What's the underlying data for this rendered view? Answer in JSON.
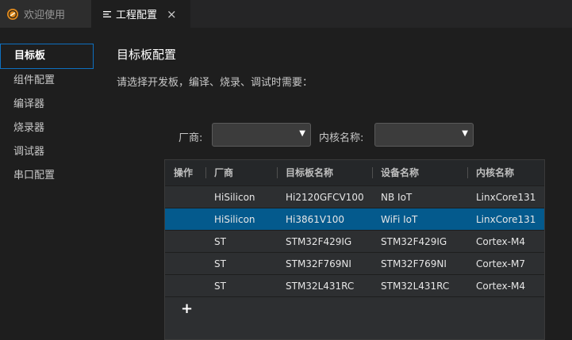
{
  "tabs": [
    {
      "label": "欢迎使用",
      "icon": "hicomponent-logo-icon",
      "active": false
    },
    {
      "label": "工程配置",
      "icon": "list-icon",
      "active": true,
      "close": "×"
    }
  ],
  "sidebar": {
    "items": [
      {
        "label": "目标板",
        "active": true
      },
      {
        "label": "组件配置"
      },
      {
        "label": "编译器"
      },
      {
        "label": "烧录器"
      },
      {
        "label": "调试器"
      },
      {
        "label": "串口配置"
      }
    ]
  },
  "main": {
    "title": "目标板配置",
    "subtitle": "请选择开发板，编译、烧录、调试时需要："
  },
  "filters": {
    "vendor_label": "厂商:",
    "vendor_value": "",
    "core_label": "内核名称:",
    "core_value": "",
    "caret": "▼"
  },
  "table": {
    "headers": [
      "操作",
      "厂商",
      "目标板名称",
      "设备名称",
      "内核名称"
    ],
    "rows": [
      {
        "op": "",
        "vendor": "HiSilicon",
        "board": "Hi2120GFCV100",
        "device": "NB IoT",
        "core": "LinxCore131",
        "selected": false
      },
      {
        "op": "",
        "vendor": "HiSilicon",
        "board": "Hi3861V100",
        "device": "WiFi IoT",
        "core": "LinxCore131",
        "selected": true
      },
      {
        "op": "",
        "vendor": "ST",
        "board": "STM32F429IG",
        "device": "STM32F429IG",
        "core": "Cortex-M4",
        "selected": false
      },
      {
        "op": "",
        "vendor": "ST",
        "board": "STM32F769NI",
        "device": "STM32F769NI",
        "core": "Cortex-M7",
        "selected": false
      },
      {
        "op": "",
        "vendor": "ST",
        "board": "STM32L431RC",
        "device": "STM32L431RC",
        "core": "Cortex-M4",
        "selected": false
      }
    ],
    "add_label": "+"
  },
  "colors": {
    "accent": "#0e70c0",
    "selected_row": "#045a8d"
  }
}
